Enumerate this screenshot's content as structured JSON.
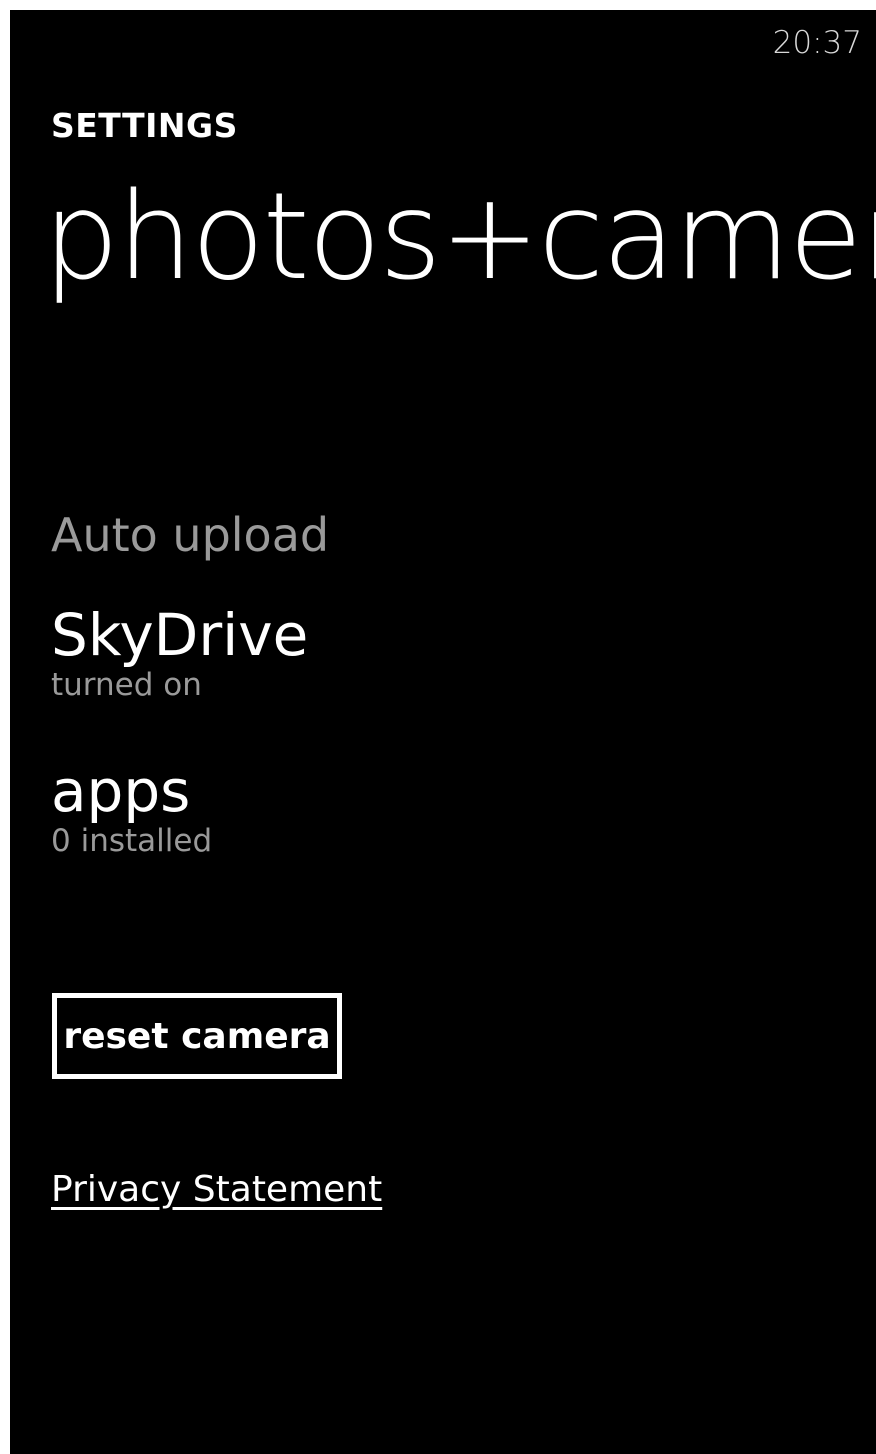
{
  "status_bar": {
    "time": "20:37"
  },
  "header": {
    "app_title": "SETTINGS",
    "page_title": "photos+camera"
  },
  "auto_upload": {
    "header": "Auto upload",
    "items": [
      {
        "title": "SkyDrive",
        "subtitle": "turned on"
      },
      {
        "title": "apps",
        "subtitle": "0 installed"
      }
    ]
  },
  "actions": {
    "reset_label": "reset camera",
    "privacy_label": "Privacy Statement"
  },
  "colors": {
    "background": "#000000",
    "foreground": "#ffffff",
    "subtle": "#9a9a9a"
  }
}
